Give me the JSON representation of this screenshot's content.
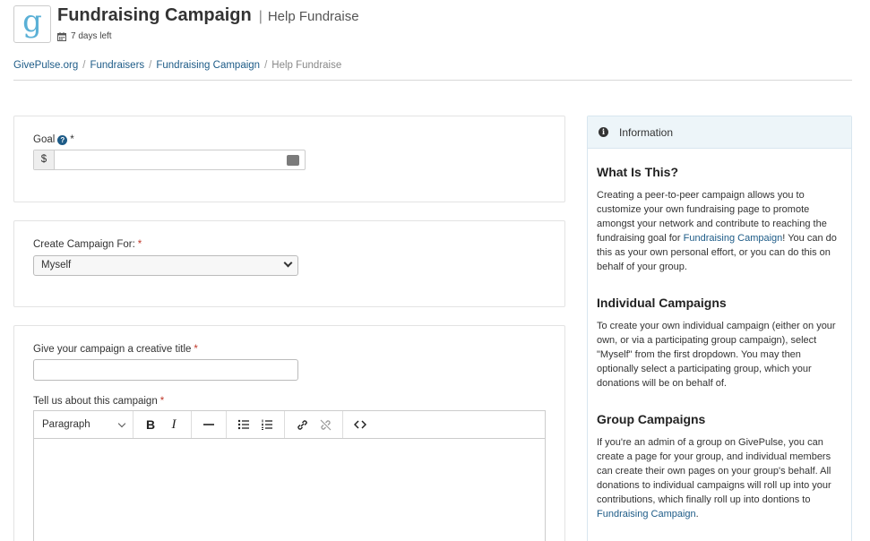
{
  "header": {
    "logo_letter": "g",
    "title": "Fundraising Campaign",
    "separator": "|",
    "subtitle": "Help Fundraise",
    "days_left": "7 days left"
  },
  "breadcrumb": [
    {
      "label": "GivePulse.org"
    },
    {
      "label": "Fundraisers"
    },
    {
      "label": "Fundraising Campaign"
    },
    {
      "label": "Help Fundraise"
    }
  ],
  "breadcrumb_sep": "/",
  "form": {
    "goal_label": "Goal",
    "goal_required": "*",
    "goal_prefix": "$",
    "goal_value": "",
    "create_for_label": "Create Campaign For:",
    "create_for_required": "*",
    "create_for_selected": "Myself",
    "title_label": "Give your campaign a creative title",
    "title_required": "*",
    "title_value": "",
    "about_label": "Tell us about this campaign",
    "about_required": "*",
    "editor_format": "Paragraph",
    "bold_label": "B",
    "italic_label": "I"
  },
  "info": {
    "header": "Information",
    "sections": [
      {
        "heading": "What Is This?",
        "text_before": "Creating a peer-to-peer campaign allows you to customize your own fundraising page to promote amongst your network and contribute to reaching the fundraising goal for ",
        "link": "Fundraising Campaign",
        "text_after": "! You can do this as your own personal effort, or you can do this on behalf of your group."
      },
      {
        "heading": "Individual Campaigns",
        "text": "To create your own individual campaign (either on your own, or via a participating group campaign), select \"Myself\" from the first dropdown. You may then optionally select a participating group, which your donations will be on behalf of."
      },
      {
        "heading": "Group Campaigns",
        "text_before": "If you're an admin of a group on GivePulse, you can create a page for your group, and individual members can create their own pages on your group's behalf. All donations to individual campaigns will roll up into your contributions, which finally roll up into dontions to ",
        "link": "Fundraising Campaign",
        "text_after": "."
      }
    ]
  },
  "colors": {
    "link": "#1d5b87",
    "required": "#c0392b",
    "logo": "#5ab0d6",
    "info_header_bg": "#edf5f9"
  },
  "icons": [
    "calendar-icon",
    "help-icon",
    "keyboard-icon",
    "chevron-down-icon",
    "info-icon",
    "bullet-list-icon",
    "numbered-list-icon",
    "link-icon",
    "unlink-icon",
    "code-icon",
    "horizontal-rule-icon"
  ]
}
